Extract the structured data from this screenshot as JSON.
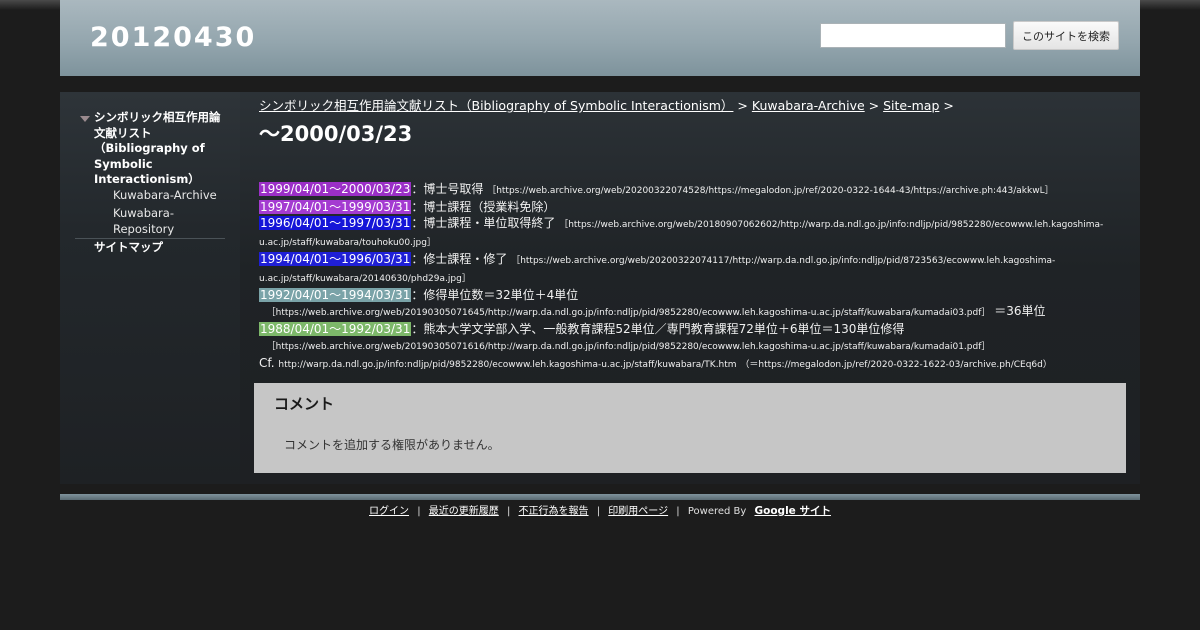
{
  "site": {
    "title": "20120430"
  },
  "search": {
    "placeholder": "",
    "button_label": "このサイトを検索"
  },
  "sidebar": {
    "main_item": "シンボリック相互作用論文献リスト（Bibliography of Symbolic Interactionism）",
    "sub_items": [
      "Kuwabara-Archive",
      "Kuwabara-Repository"
    ],
    "sitemap": "サイトマップ"
  },
  "breadcrumb": {
    "items": [
      "シンボリック相互作用論文献リスト（Bibliography of Symbolic Interactionism）",
      "Kuwabara-Archive",
      "Site-map"
    ],
    "separator": ">"
  },
  "page": {
    "title": "～2000/03/23"
  },
  "entries": [
    {
      "period": "1999/04/01～2000/03/23",
      "color": "#9b2fc7",
      "text": "：博士号取得",
      "link": "https://web.archive.org/web/20200322074528/https://megalodon.jp/ref/2020-0322-1644-43/https://archive.ph:443/akkwL"
    },
    {
      "period": "1997/04/01～1999/03/31",
      "color": "#a43bd1",
      "text": "：博士課程（授業料免除）",
      "link": ""
    },
    {
      "period": "1996/04/01～1997/03/31",
      "color": "#1515d8",
      "text": "：博士課程・単位取得終了",
      "link": "https://web.archive.org/web/20180907062602/http://warp.da.ndl.go.jp/info:ndljp/pid/9852280/ecowww.leh.kagoshima-u.ac.jp/staff/kuwabara/touhoku00.jpg"
    },
    {
      "period": "1994/04/01～1996/03/31",
      "color": "#1f1fd6",
      "text": "：修士課程・修了",
      "link": "https://web.archive.org/web/20200322074117/http://warp.da.ndl.go.jp/info:ndljp/pid/8723563/ecowww.leh.kagoshima-u.ac.jp/staff/kuwabara/20140630/phd29a.jpg"
    },
    {
      "period": "1992/04/01～1994/03/31",
      "color": "#7aa3a8",
      "text": "：修得単位数＝32単位＋4単位",
      "link": "https://web.archive.org/web/20190305071645/http://warp.da.ndl.go.jp/info:ndljp/pid/9852280/ecowww.leh.kagoshima-u.ac.jp/staff/kuwabara/kumadai03.pdf",
      "suffix": "＝36単位"
    },
    {
      "period": "1988/04/01～1992/03/31",
      "color": "#7db86a",
      "text": "：熊本大学文学部入学、一般教育課程52単位／専門教育課程72単位＋6単位＝130単位修得",
      "link": "https://web.archive.org/web/20190305071616/http://warp.da.ndl.go.jp/info:ndljp/pid/9852280/ecowww.leh.kagoshima-u.ac.jp/staff/kuwabara/kumadai01.pdf"
    }
  ],
  "cf": {
    "label": "Cf.",
    "url": "http://warp.da.ndl.go.jp/info:ndljp/pid/9852280/ecowww.leh.kagoshima-u.ac.jp/staff/kuwabara/TK.htm",
    "alt": "（＝https://megalodon.jp/ref/2020-0322-1622-03/archive.ph/CEq6d）"
  },
  "comments": {
    "title": "コメント",
    "text": "コメントを追加する権限がありません。"
  },
  "footer": {
    "links": [
      "ログイン",
      "最近の更新履歴",
      "不正行為を報告",
      "印刷用ページ"
    ],
    "powered": "Powered By",
    "brand": "Google サイト",
    "separator": "|"
  }
}
